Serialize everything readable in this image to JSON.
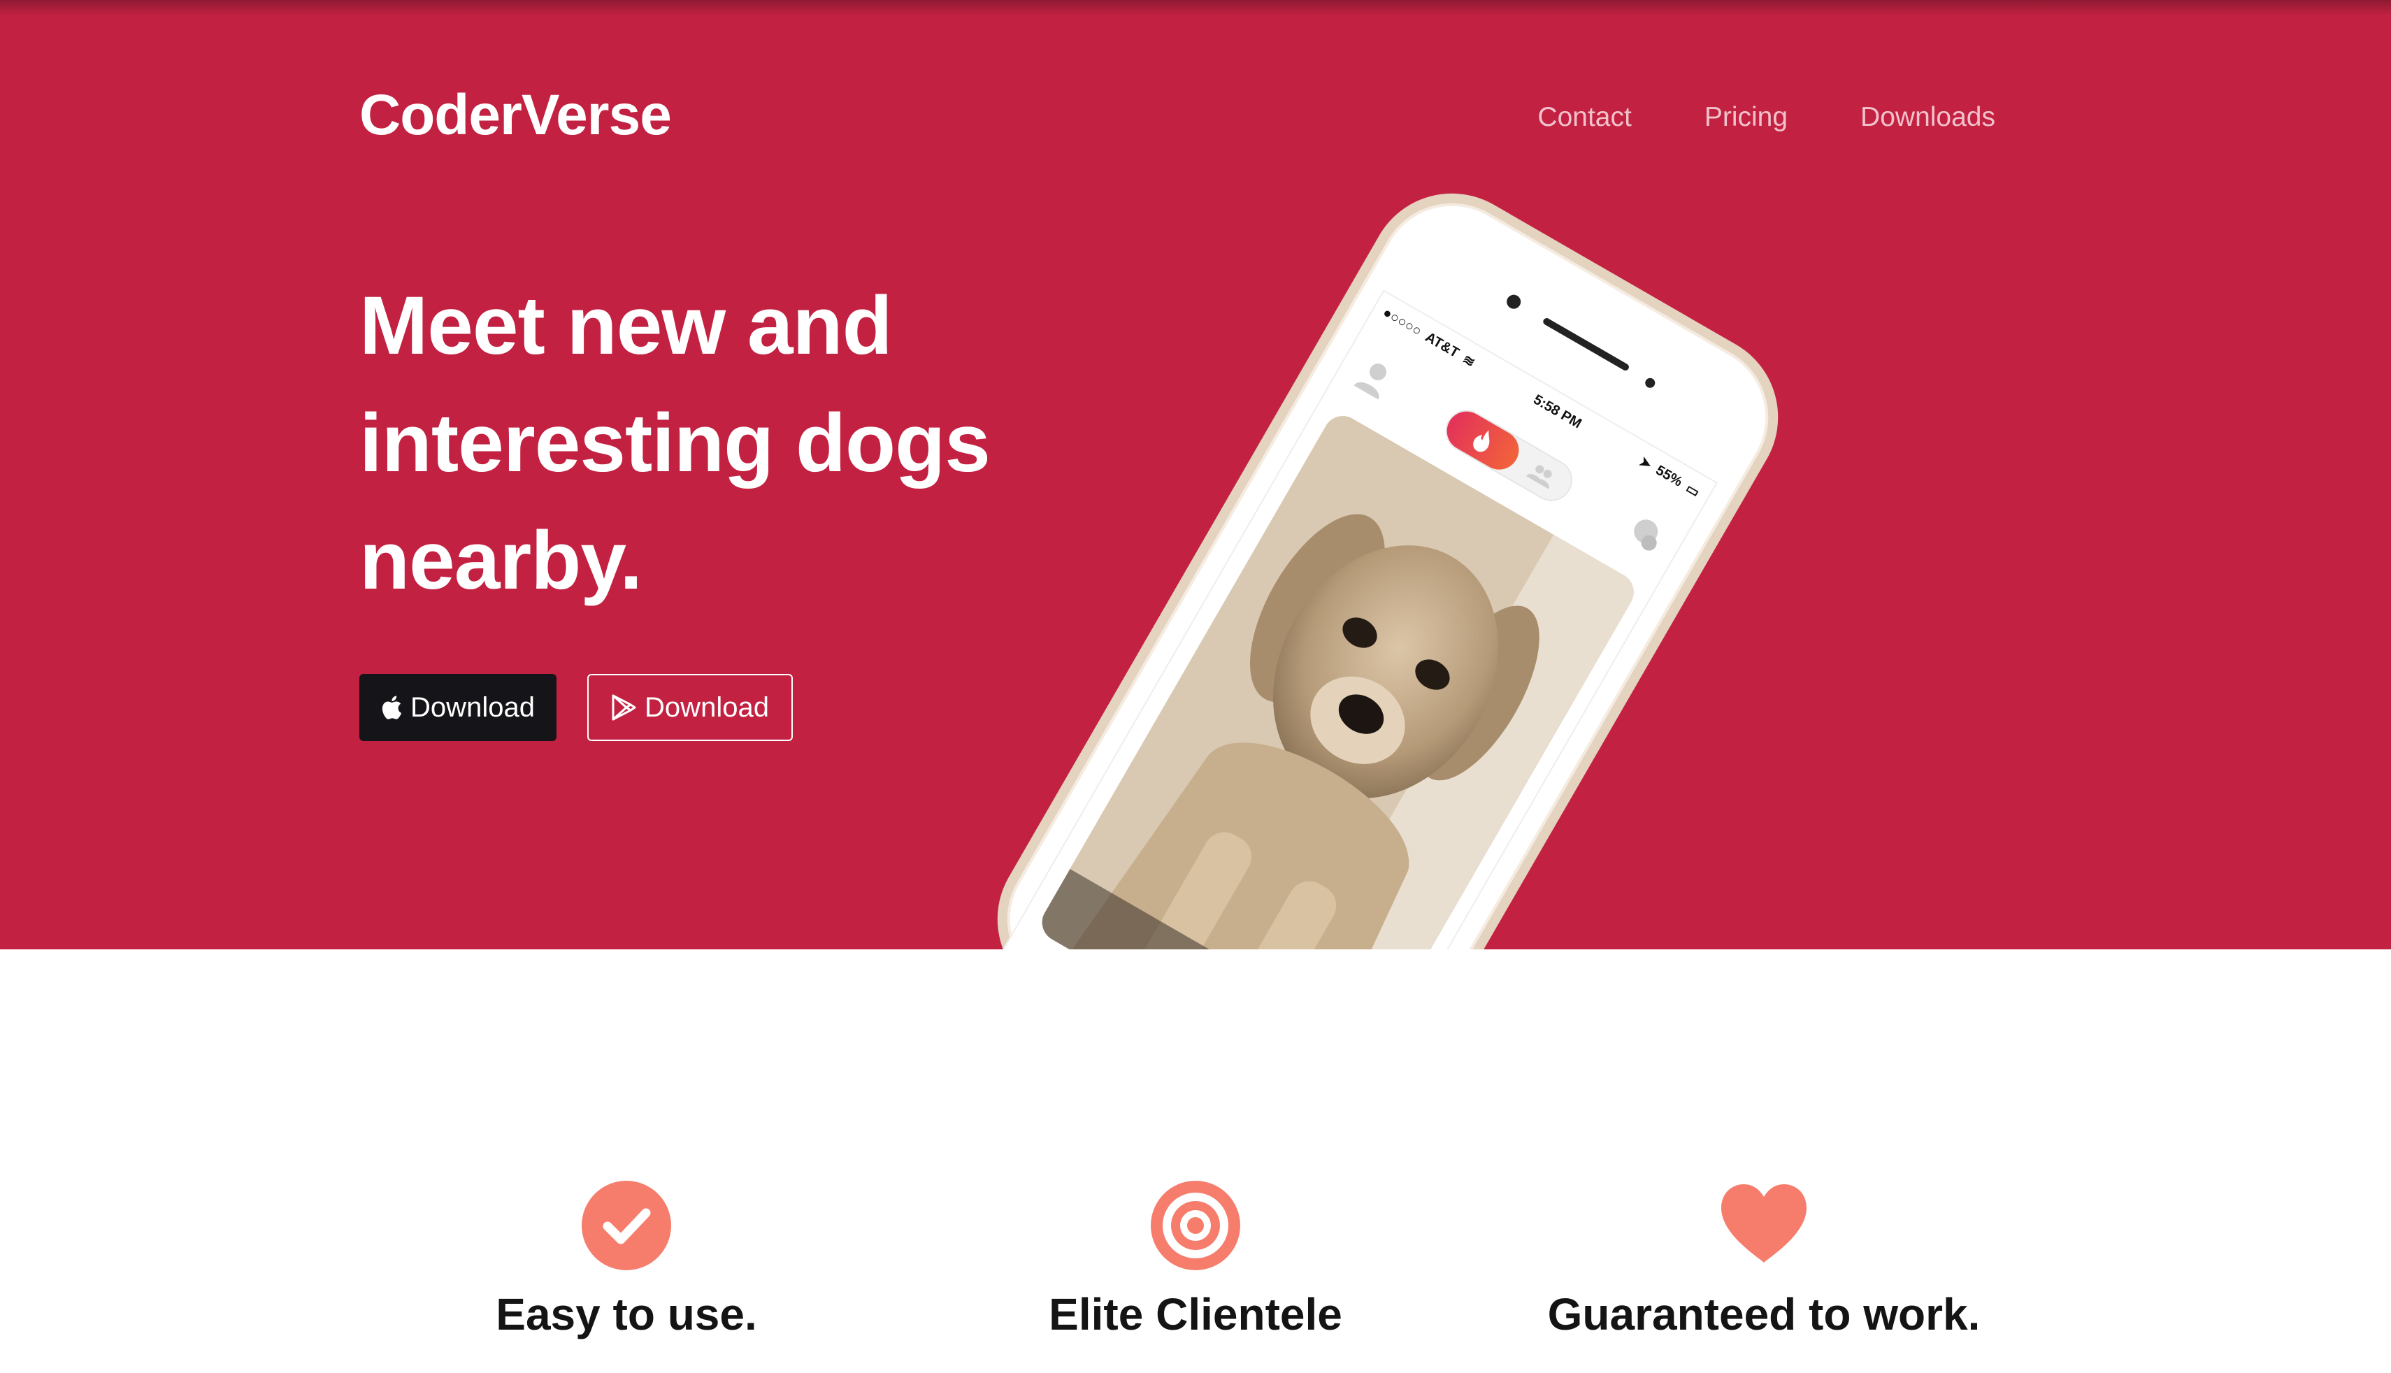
{
  "brand": "CoderVerse",
  "nav": {
    "contact": "Contact",
    "pricing": "Pricing",
    "downloads": "Downloads"
  },
  "hero": {
    "headline_line1": "Meet new and",
    "headline_line2": "interesting dogs",
    "headline_line3": "nearby.",
    "apple_download_label": "Download",
    "play_download_label": "Download"
  },
  "phone": {
    "carrier": "AT&T",
    "time": "5:58 PM",
    "battery": "55%"
  },
  "features": [
    {
      "title": "Easy to use.",
      "icon": "check-circle-icon"
    },
    {
      "title": "Elite Clientele",
      "icon": "target-icon"
    },
    {
      "title": "Guaranteed to work.",
      "icon": "heart-icon"
    }
  ],
  "colors": {
    "hero_bg": "#c32141",
    "accent": "#f67d6c",
    "dark_button": "#151519"
  }
}
